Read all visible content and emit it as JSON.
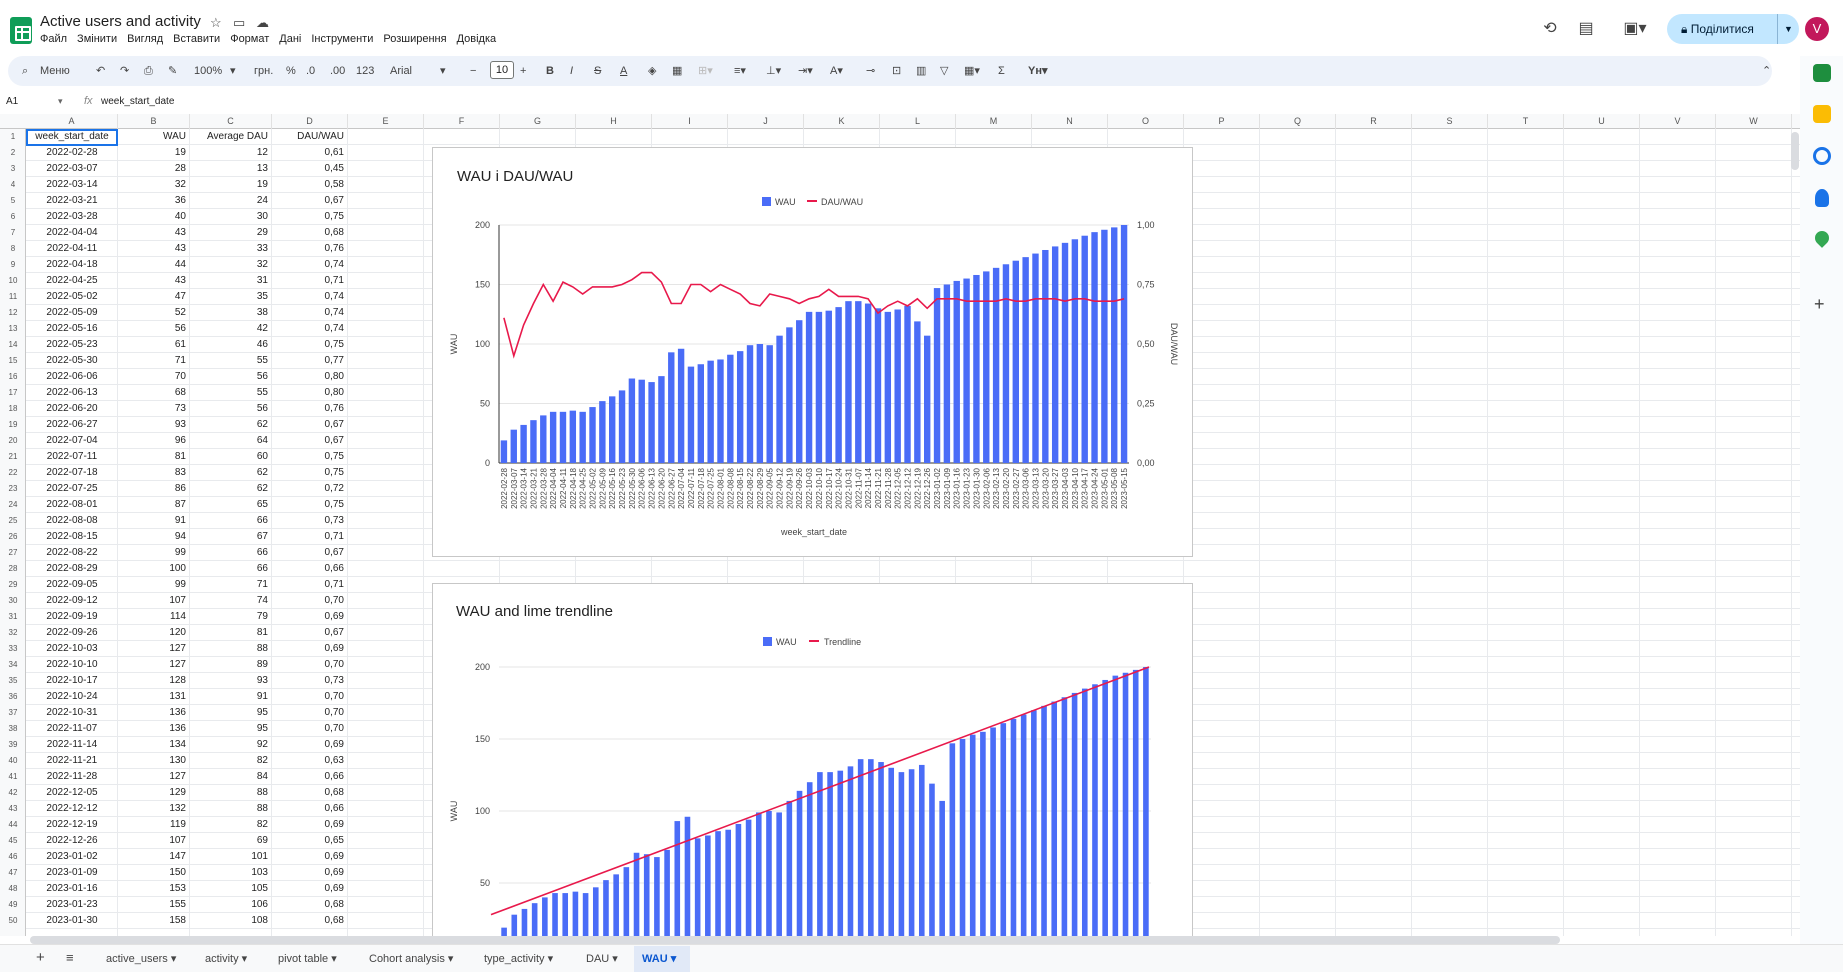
{
  "doc": {
    "title": "Active users and activity"
  },
  "menu": [
    "Файл",
    "Змінити",
    "Вигляд",
    "Вставити",
    "Формат",
    "Дані",
    "Інструменти",
    "Розширення",
    "Довідка"
  ],
  "share": {
    "label": "Поділитися"
  },
  "avatar": {
    "letter": "V"
  },
  "toolbar": {
    "search": "Меню",
    "zoom": "100%",
    "currency": "грн.",
    "percent": "%",
    "dec_less": ".0",
    "dec_more": ".00",
    "number": "123",
    "font": "Arial",
    "font_size": "10"
  },
  "formula": {
    "cell": "A1",
    "fx": "fx",
    "value": "week_start_date"
  },
  "columns": [
    "A",
    "B",
    "C",
    "D",
    "E",
    "F",
    "G",
    "H",
    "I",
    "J",
    "K",
    "L",
    "M",
    "N",
    "O",
    "P",
    "Q",
    "R",
    "S",
    "T",
    "U",
    "V",
    "W"
  ],
  "rows": [
    "1",
    "2",
    "3",
    "4",
    "5",
    "6",
    "7",
    "8",
    "9",
    "10",
    "11",
    "12",
    "13",
    "14",
    "15",
    "16",
    "17",
    "18",
    "19",
    "20",
    "21",
    "22",
    "23",
    "24",
    "25",
    "26",
    "27",
    "28",
    "29",
    "30",
    "31",
    "32",
    "33",
    "34",
    "35",
    "36",
    "37",
    "38",
    "39",
    "40",
    "41",
    "42",
    "43",
    "44",
    "45",
    "46",
    "47",
    "48",
    "49",
    "50"
  ],
  "table": {
    "headers": [
      "week_start_date",
      "WAU",
      "Average DAU",
      "DAU/WAU"
    ],
    "data": [
      [
        "2022-02-28",
        "19",
        "12",
        "0,61"
      ],
      [
        "2022-03-07",
        "28",
        "13",
        "0,45"
      ],
      [
        "2022-03-14",
        "32",
        "19",
        "0,58"
      ],
      [
        "2022-03-21",
        "36",
        "24",
        "0,67"
      ],
      [
        "2022-03-28",
        "40",
        "30",
        "0,75"
      ],
      [
        "2022-04-04",
        "43",
        "29",
        "0,68"
      ],
      [
        "2022-04-11",
        "43",
        "33",
        "0,76"
      ],
      [
        "2022-04-18",
        "44",
        "32",
        "0,74"
      ],
      [
        "2022-04-25",
        "43",
        "31",
        "0,71"
      ],
      [
        "2022-05-02",
        "47",
        "35",
        "0,74"
      ],
      [
        "2022-05-09",
        "52",
        "38",
        "0,74"
      ],
      [
        "2022-05-16",
        "56",
        "42",
        "0,74"
      ],
      [
        "2022-05-23",
        "61",
        "46",
        "0,75"
      ],
      [
        "2022-05-30",
        "71",
        "55",
        "0,77"
      ],
      [
        "2022-06-06",
        "70",
        "56",
        "0,80"
      ],
      [
        "2022-06-13",
        "68",
        "55",
        "0,80"
      ],
      [
        "2022-06-20",
        "73",
        "56",
        "0,76"
      ],
      [
        "2022-06-27",
        "93",
        "62",
        "0,67"
      ],
      [
        "2022-07-04",
        "96",
        "64",
        "0,67"
      ],
      [
        "2022-07-11",
        "81",
        "60",
        "0,75"
      ],
      [
        "2022-07-18",
        "83",
        "62",
        "0,75"
      ],
      [
        "2022-07-25",
        "86",
        "62",
        "0,72"
      ],
      [
        "2022-08-01",
        "87",
        "65",
        "0,75"
      ],
      [
        "2022-08-08",
        "91",
        "66",
        "0,73"
      ],
      [
        "2022-08-15",
        "94",
        "67",
        "0,71"
      ],
      [
        "2022-08-22",
        "99",
        "66",
        "0,67"
      ],
      [
        "2022-08-29",
        "100",
        "66",
        "0,66"
      ],
      [
        "2022-09-05",
        "99",
        "71",
        "0,71"
      ],
      [
        "2022-09-12",
        "107",
        "74",
        "0,70"
      ],
      [
        "2022-09-19",
        "114",
        "79",
        "0,69"
      ],
      [
        "2022-09-26",
        "120",
        "81",
        "0,67"
      ],
      [
        "2022-10-03",
        "127",
        "88",
        "0,69"
      ],
      [
        "2022-10-10",
        "127",
        "89",
        "0,70"
      ],
      [
        "2022-10-17",
        "128",
        "93",
        "0,73"
      ],
      [
        "2022-10-24",
        "131",
        "91",
        "0,70"
      ],
      [
        "2022-10-31",
        "136",
        "95",
        "0,70"
      ],
      [
        "2022-11-07",
        "136",
        "95",
        "0,70"
      ],
      [
        "2022-11-14",
        "134",
        "92",
        "0,69"
      ],
      [
        "2022-11-21",
        "130",
        "82",
        "0,63"
      ],
      [
        "2022-11-28",
        "127",
        "84",
        "0,66"
      ],
      [
        "2022-12-05",
        "129",
        "88",
        "0,68"
      ],
      [
        "2022-12-12",
        "132",
        "88",
        "0,66"
      ],
      [
        "2022-12-19",
        "119",
        "82",
        "0,69"
      ],
      [
        "2022-12-26",
        "107",
        "69",
        "0,65"
      ],
      [
        "2023-01-02",
        "147",
        "101",
        "0,69"
      ],
      [
        "2023-01-09",
        "150",
        "103",
        "0,69"
      ],
      [
        "2023-01-16",
        "153",
        "105",
        "0,69"
      ],
      [
        "2023-01-23",
        "155",
        "106",
        "0,68"
      ],
      [
        "2023-01-30",
        "158",
        "108",
        "0,68"
      ]
    ]
  },
  "chart_data": [
    {
      "type": "bar",
      "title": "WAU і DAU/WAU",
      "xlabel": "week_start_date",
      "ylabel": "WAU",
      "y2label": "DAU/WAU",
      "ylim": [
        0,
        200
      ],
      "y2lim": [
        0,
        1
      ],
      "yticks": [
        "0",
        "50",
        "100",
        "150",
        "200"
      ],
      "y2ticks": [
        "0,00",
        "0,25",
        "0,50",
        "0,75",
        "1,00"
      ],
      "legend": [
        "WAU",
        "DAU/WAU"
      ],
      "legend_position": "top",
      "categories": [
        "2022-02-28",
        "2022-03-07",
        "2022-03-14",
        "2022-03-21",
        "2022-03-28",
        "2022-04-04",
        "2022-04-11",
        "2022-04-18",
        "2022-04-25",
        "2022-05-02",
        "2022-05-09",
        "2022-05-16",
        "2022-05-23",
        "2022-05-30",
        "2022-06-06",
        "2022-06-13",
        "2022-06-20",
        "2022-06-27",
        "2022-07-04",
        "2022-07-11",
        "2022-07-18",
        "2022-07-25",
        "2022-08-01",
        "2022-08-08",
        "2022-08-15",
        "2022-08-22",
        "2022-08-29",
        "2022-09-05",
        "2022-09-12",
        "2022-09-19",
        "2022-09-26",
        "2022-10-03",
        "2022-10-10",
        "2022-10-17",
        "2022-10-24",
        "2022-10-31",
        "2022-11-07",
        "2022-11-14",
        "2022-11-21",
        "2022-11-28",
        "2022-12-05",
        "2022-12-12",
        "2022-12-19",
        "2022-12-26",
        "2023-01-02",
        "2023-01-09",
        "2023-01-16",
        "2023-01-23",
        "2023-01-30",
        "2023-02-06",
        "2023-02-13",
        "2023-02-20",
        "2023-02-27",
        "2023-03-06",
        "2023-03-13",
        "2023-03-20",
        "2023-03-27",
        "2023-04-03",
        "2023-04-10",
        "2023-04-17",
        "2023-04-24",
        "2023-05-01",
        "2023-05-08",
        "2023-05-15"
      ],
      "series": [
        {
          "name": "WAU",
          "kind": "bar",
          "color": "#4a6cf7",
          "values": [
            19,
            28,
            32,
            36,
            40,
            43,
            43,
            44,
            43,
            47,
            52,
            56,
            61,
            71,
            70,
            68,
            73,
            93,
            96,
            81,
            83,
            86,
            87,
            91,
            94,
            99,
            100,
            99,
            107,
            114,
            120,
            127,
            127,
            128,
            131,
            136,
            136,
            134,
            130,
            127,
            129,
            132,
            119,
            107,
            147,
            150,
            153,
            155,
            158,
            161,
            164,
            167,
            170,
            173,
            176,
            179,
            182,
            185,
            188,
            191,
            194,
            196,
            198,
            200
          ]
        },
        {
          "name": "DAU/WAU",
          "kind": "line",
          "axis": "right",
          "color": "#e8194b",
          "values": [
            0.61,
            0.45,
            0.58,
            0.67,
            0.75,
            0.68,
            0.76,
            0.74,
            0.71,
            0.74,
            0.74,
            0.74,
            0.75,
            0.77,
            0.8,
            0.8,
            0.76,
            0.67,
            0.67,
            0.75,
            0.75,
            0.72,
            0.75,
            0.73,
            0.71,
            0.67,
            0.66,
            0.71,
            0.7,
            0.69,
            0.67,
            0.69,
            0.7,
            0.73,
            0.7,
            0.7,
            0.7,
            0.69,
            0.63,
            0.66,
            0.68,
            0.66,
            0.69,
            0.65,
            0.69,
            0.69,
            0.69,
            0.68,
            0.68,
            0.68,
            0.68,
            0.69,
            0.68,
            0.68,
            0.69,
            0.69,
            0.69,
            0.68,
            0.69,
            0.69,
            0.68,
            0.68,
            0.68,
            0.69
          ]
        }
      ]
    },
    {
      "type": "bar",
      "title": "WAU and lime trendline",
      "ylabel": "WAU",
      "ylim": [
        0,
        200
      ],
      "yticks": [
        "50",
        "100",
        "150",
        "200"
      ],
      "legend": [
        "WAU",
        "Trendline"
      ],
      "legend_position": "top",
      "series": [
        {
          "name": "WAU",
          "kind": "bar",
          "color": "#4a6cf7",
          "values": [
            19,
            28,
            32,
            36,
            40,
            43,
            43,
            44,
            43,
            47,
            52,
            56,
            61,
            71,
            70,
            68,
            73,
            93,
            96,
            81,
            83,
            86,
            87,
            91,
            94,
            99,
            100,
            99,
            107,
            114,
            120,
            127,
            127,
            128,
            131,
            136,
            136,
            134,
            130,
            127,
            129,
            132,
            119,
            107,
            147,
            150,
            153,
            155,
            158,
            161,
            164,
            167,
            170,
            173,
            176,
            179,
            182,
            185,
            188,
            191,
            194,
            196,
            198,
            200
          ]
        },
        {
          "name": "Trendline",
          "kind": "line",
          "color": "#e8194b",
          "values": [
            28,
            200
          ]
        }
      ]
    }
  ],
  "sheets": [
    "active_users",
    "activity",
    "pivot table",
    "Cohort analysis",
    "type_activity",
    "DAU",
    "WAU"
  ],
  "colors": {
    "accent": "#0b57d0",
    "bar": "#4a6cf7",
    "line": "#e8194b",
    "sheets_green": "#0f9d58"
  }
}
